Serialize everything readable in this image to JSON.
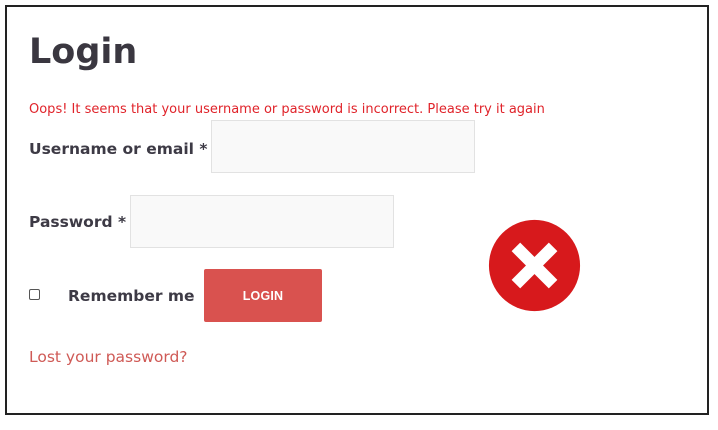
{
  "form": {
    "title": "Login",
    "error_message": "Oops! It seems that your username or password is incorrect. Please try it again",
    "username": {
      "label": "Username or email",
      "required_marker": "*",
      "value": ""
    },
    "password": {
      "label": "Password",
      "required_marker": "*",
      "value": ""
    },
    "remember_me": {
      "label": "Remember me",
      "checked": false
    },
    "login_button_label": "LOGIN",
    "lost_password_link": "Lost your password?"
  },
  "status_icon": {
    "name": "error-x-icon",
    "color": "#d7191c"
  },
  "colors": {
    "error_text": "#e0232a",
    "button_bg": "#d9524f",
    "link": "#cf5a56",
    "heading": "#3a3740"
  }
}
